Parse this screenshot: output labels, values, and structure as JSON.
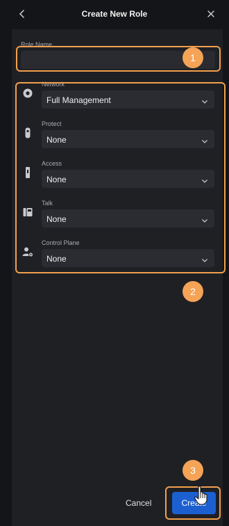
{
  "header": {
    "title": "Create New Role",
    "back_icon": "chevron-left-icon",
    "close_icon": "close-icon"
  },
  "role_name": {
    "label": "Role Name",
    "value": "",
    "placeholder": ""
  },
  "apps": [
    {
      "label": "Network",
      "value": "Full Management",
      "icon": "network-icon"
    },
    {
      "label": "Protect",
      "value": "None",
      "icon": "protect-camera-icon"
    },
    {
      "label": "Access",
      "value": "None",
      "icon": "access-reader-icon"
    },
    {
      "label": "Talk",
      "value": "None",
      "icon": "talk-phone-icon"
    },
    {
      "label": "Control Plane",
      "value": "None",
      "icon": "control-plane-icon"
    }
  ],
  "footer": {
    "cancel_label": "Cancel",
    "create_label": "Create"
  },
  "annotations": {
    "step1": "1",
    "step2": "2",
    "step3": "3"
  },
  "colors": {
    "accent": "#1c5fd1",
    "highlight": "#f2a04f",
    "background": "#1f2024"
  }
}
